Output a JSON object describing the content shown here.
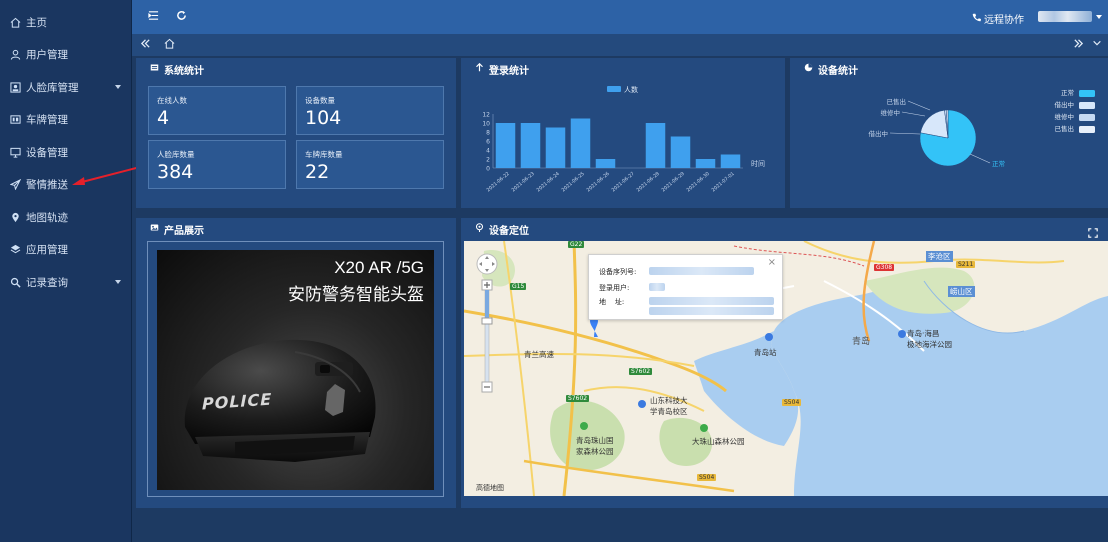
{
  "sidebar": {
    "items": [
      {
        "label": "主页",
        "icon": "home-icon",
        "expandable": false
      },
      {
        "label": "用户管理",
        "icon": "user-icon",
        "expandable": false
      },
      {
        "label": "人脸库管理",
        "icon": "face-library-icon",
        "expandable": true
      },
      {
        "label": "车牌管理",
        "icon": "license-plate-icon",
        "expandable": false
      },
      {
        "label": "设备管理",
        "icon": "monitor-icon",
        "expandable": false
      },
      {
        "label": "警情推送",
        "icon": "send-icon",
        "expandable": false
      },
      {
        "label": "地图轨迹",
        "icon": "map-pin-icon",
        "expandable": false
      },
      {
        "label": "应用管理",
        "icon": "apps-icon",
        "expandable": false
      },
      {
        "label": "记录查询",
        "icon": "search-icon",
        "expandable": true
      }
    ]
  },
  "topbar": {
    "remote_label": "远程协作",
    "icons": [
      "menu-fold-icon",
      "refresh-icon",
      "phone-icon"
    ]
  },
  "tabbar": {
    "icons": [
      "double-left-icon",
      "home-icon",
      "double-right-icon",
      "chevron-down-icon"
    ]
  },
  "system_stats": {
    "title": "系统统计",
    "boxes": [
      {
        "label": "在线人数",
        "value": "4"
      },
      {
        "label": "设备数量",
        "value": "104"
      },
      {
        "label": "人脸库数量",
        "value": "384"
      },
      {
        "label": "车牌库数量",
        "value": "22"
      }
    ]
  },
  "login_stats": {
    "title": "登录统计",
    "chart_data": {
      "type": "bar",
      "legend": [
        "人数"
      ],
      "xlabel": "时间",
      "ylim": [
        0,
        12
      ],
      "yticks": [
        "0",
        "2",
        "4",
        "6",
        "8",
        "10",
        "12"
      ],
      "categories": [
        "2021-06-22",
        "2021-06-23",
        "2021-06-24",
        "2021-06-25",
        "2021-06-26",
        "2021-06-27",
        "2021-06-28",
        "2021-06-29",
        "2021-06-30",
        "2021-07-01"
      ],
      "series": [
        {
          "name": "人数",
          "values": [
            10,
            10,
            9,
            11,
            2,
            0,
            10,
            7,
            2,
            3
          ]
        }
      ],
      "color": "#3fa0ee"
    }
  },
  "device_stats": {
    "title": "设备统计",
    "chart_data": {
      "type": "pie",
      "legend": [
        "正常",
        "借出中",
        "维修中",
        "已售出"
      ],
      "legend_colors": [
        "#33c3f7",
        "#d7e7fa",
        "#c6daf3",
        "#e8f0fa"
      ],
      "slices": [
        {
          "name": "正常",
          "value": 78
        },
        {
          "name": "借出中",
          "value": 20
        },
        {
          "name": "维修中",
          "value": 1
        },
        {
          "name": "已售出",
          "value": 1
        }
      ],
      "legend_position": "top-right"
    }
  },
  "product": {
    "title": "产品展示",
    "headline_1": "X20  AR /5G",
    "headline_2": "安防警务智能头盔",
    "helmet_text": "POLICE"
  },
  "device_location": {
    "title": "设备定位",
    "popup": {
      "serial_label": "设备序列号:",
      "user_label": "登录用户:",
      "address_label": "地    址:",
      "close": "×"
    },
    "map_labels": {
      "qingdao": "青岛",
      "qingdao_station": "青岛站",
      "qingdao_bay": "青岛·海昌\n极地海洋公园",
      "shandong_univ": "山东科技大\n学青岛校区",
      "zhushan": "青岛珠山国\n家森林公园",
      "dazhushan": "大珠山森林公园",
      "laoshan": "崂山区",
      "licang": "李沧区",
      "qingsan": "青兰高速",
      "mapbrand": "高德地图"
    },
    "roads": [
      "G22",
      "G15",
      "S7602",
      "S7602",
      "S504",
      "S504",
      "G308",
      "S211"
    ]
  },
  "colors": {
    "sidebar_bg": "#1a3660",
    "topbar_bg": "#2d62a6",
    "panel_bg": "#244a7f",
    "accent": "#33c3f7",
    "annotation_arrow": "#e5202a"
  }
}
